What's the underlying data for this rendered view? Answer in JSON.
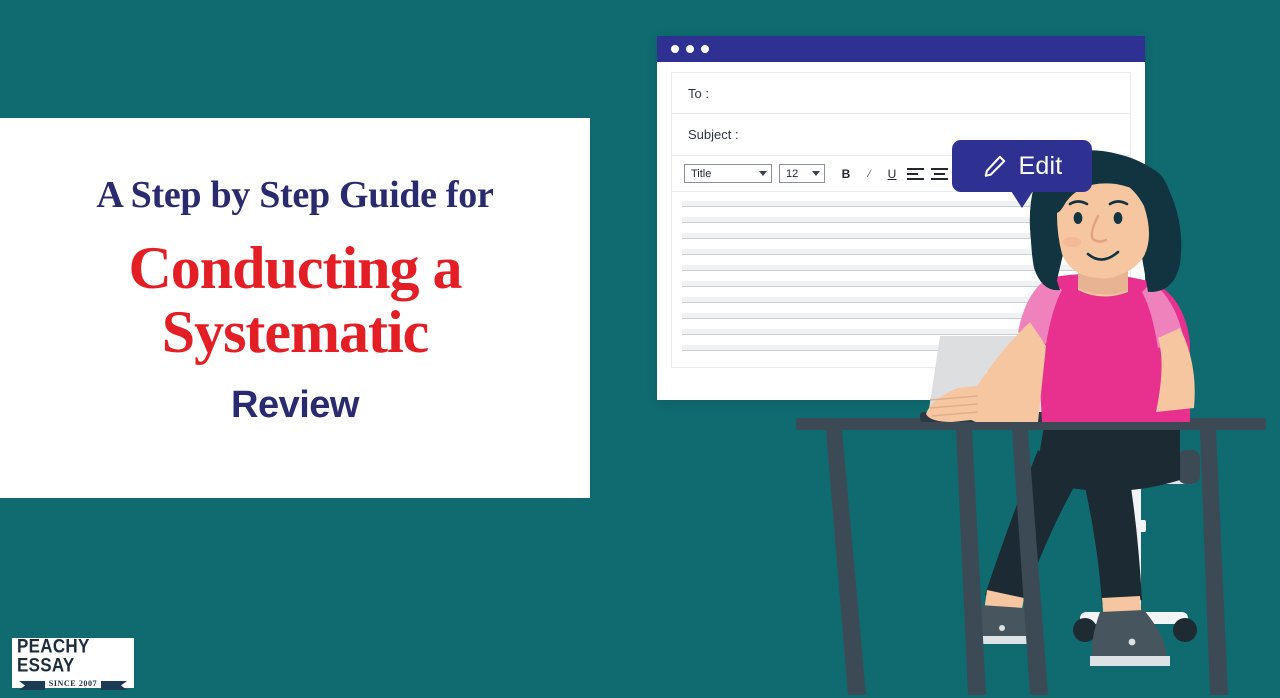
{
  "theme": {
    "background": "#0F6B70",
    "navy": "#2A2A6E",
    "red": "#E31E24",
    "indigo": "#2E3192",
    "pink": "#E8318F",
    "skin": "#F5C6A0",
    "hair": "#123340",
    "desk": "#3C4A55",
    "laptop": "#DCDEE0"
  },
  "title_card": {
    "line1": "A Step by Step Guide for",
    "line2": "Conducting a",
    "line3": "Systematic",
    "line4": "Review"
  },
  "logo": {
    "wordmark": "PEACHY ESSAY",
    "tagline": "SINCE 2007"
  },
  "editor": {
    "window_dots": [
      "dot",
      "dot",
      "dot"
    ],
    "fields": [
      {
        "label": "To :",
        "value": ""
      },
      {
        "label": "Subject :",
        "value": ""
      }
    ],
    "toolbar": {
      "style_select": "Title",
      "size_select": "12",
      "bold_label": "B",
      "italic_label": "/",
      "underline_label": "U",
      "align_left_name": "align-left",
      "align_center_name": "align-center",
      "align_right_name": "align-right"
    },
    "document_line_count": 10
  },
  "edit_badge": {
    "label": "Edit",
    "icon": "pencil-icon"
  }
}
